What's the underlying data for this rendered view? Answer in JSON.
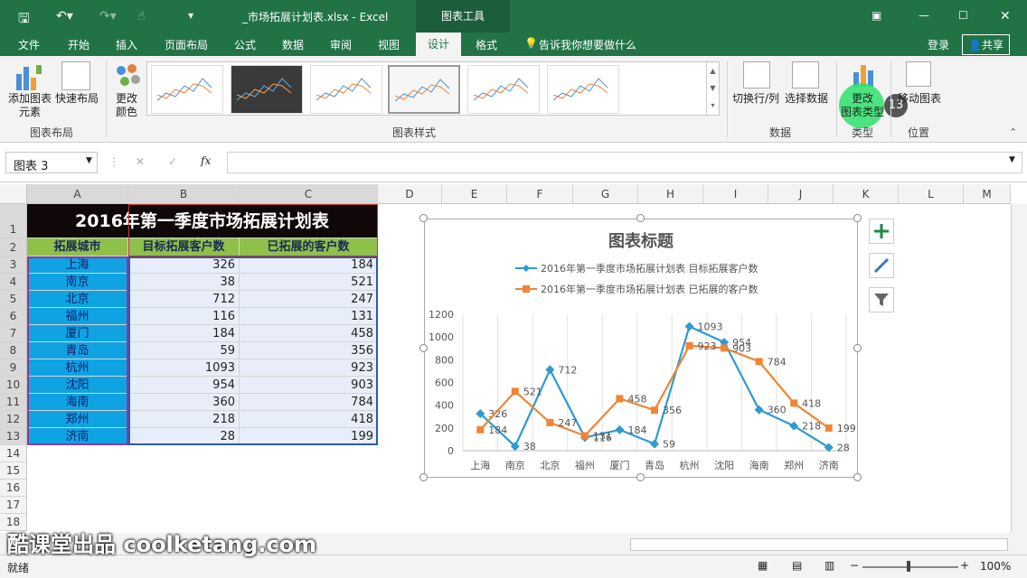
{
  "title_bar": {
    "file_title": "_市场拓展计划表.xlsx - Excel",
    "context_title": "图表工具"
  },
  "tabs": [
    "文件",
    "开始",
    "插入",
    "页面布局",
    "公式",
    "数据",
    "审阅",
    "视图",
    "设计",
    "格式"
  ],
  "tell_me": "告诉我你想要做什么",
  "login": "登录",
  "share": "共享",
  "ribbon": {
    "add_element": "添加图表\n元素",
    "quick_layout": "快速布局",
    "change_colors": "更改\n颜色",
    "group_layout": "图表布局",
    "group_styles": "图表样式",
    "switch_rowcol": "切换行/列",
    "select_data": "选择数据",
    "group_data": "数据",
    "change_type": "更改\n图表类型",
    "group_type": "类型",
    "move_chart": "移动图表",
    "group_location": "位置",
    "badge": "13"
  },
  "name_box": "图表 3",
  "fx": "fx",
  "columns": [
    "A",
    "B",
    "C",
    "D",
    "E",
    "F",
    "G",
    "H",
    "I",
    "J",
    "K",
    "L",
    "M"
  ],
  "rows": [
    "1",
    "2",
    "3",
    "4",
    "5",
    "6",
    "7",
    "8",
    "9",
    "10",
    "11",
    "12",
    "13",
    "14",
    "15",
    "16",
    "17",
    "18"
  ],
  "table": {
    "title": "2016年第一季度市场拓展计划表",
    "headers": [
      "拓展城市",
      "目标拓展客户数",
      "已拓展的客户数"
    ],
    "cities": [
      "上海",
      "南京",
      "北京",
      "福州",
      "厦门",
      "青岛",
      "杭州",
      "沈阳",
      "海南",
      "郑州",
      "济南"
    ],
    "target": [
      326,
      38,
      712,
      116,
      184,
      59,
      1093,
      954,
      360,
      218,
      28
    ],
    "done": [
      184,
      521,
      247,
      131,
      458,
      356,
      923,
      903,
      784,
      418,
      199
    ]
  },
  "chart_data": {
    "type": "line",
    "title": "图表标题",
    "categories": [
      "上海",
      "南京",
      "北京",
      "福州",
      "厦门",
      "青岛",
      "杭州",
      "沈阳",
      "海南",
      "郑州",
      "济南"
    ],
    "series": [
      {
        "name": "2016年第一季度市场拓展计划表 目标拓展客户数",
        "values": [
          326,
          38,
          712,
          116,
          184,
          59,
          1093,
          954,
          360,
          218,
          28
        ],
        "color": "#2e9bd1",
        "marker": "diamond"
      },
      {
        "name": "2016年第一季度市场拓展计划表 已拓展的客户数",
        "values": [
          184,
          521,
          247,
          131,
          458,
          356,
          923,
          903,
          784,
          418,
          199
        ],
        "color": "#ef8535",
        "marker": "square"
      }
    ],
    "ylim": [
      0,
      1200
    ],
    "yticks": [
      "0",
      "200",
      "400",
      "600",
      "800",
      "1000",
      "1200"
    ],
    "grid": true,
    "legend": "top"
  },
  "status": {
    "ready": "就绪",
    "zoom": "100%"
  },
  "watermark": "酷课堂出品 coolketang.com"
}
